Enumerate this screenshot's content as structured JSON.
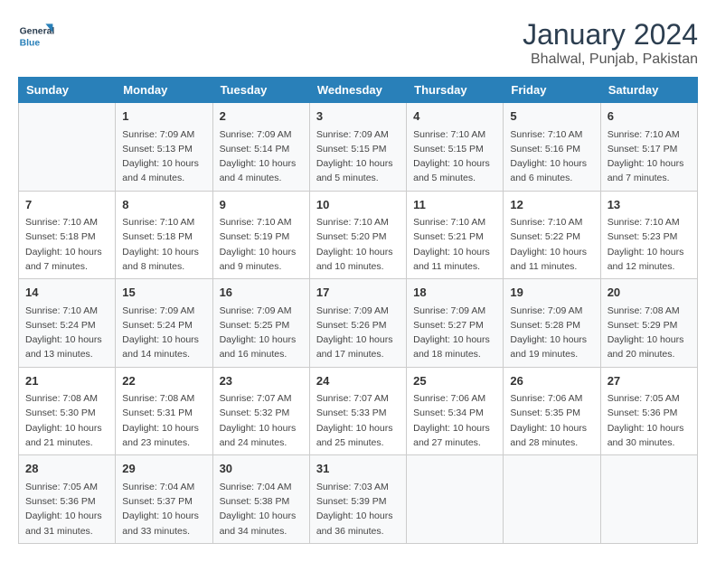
{
  "header": {
    "logo_general": "General",
    "logo_blue": "Blue",
    "title": "January 2024",
    "subtitle": "Bhalwal, Punjab, Pakistan"
  },
  "calendar": {
    "days_of_week": [
      "Sunday",
      "Monday",
      "Tuesday",
      "Wednesday",
      "Thursday",
      "Friday",
      "Saturday"
    ],
    "weeks": [
      [
        {
          "date": "",
          "info": ""
        },
        {
          "date": "1",
          "info": "Sunrise: 7:09 AM\nSunset: 5:13 PM\nDaylight: 10 hours\nand 4 minutes."
        },
        {
          "date": "2",
          "info": "Sunrise: 7:09 AM\nSunset: 5:14 PM\nDaylight: 10 hours\nand 4 minutes."
        },
        {
          "date": "3",
          "info": "Sunrise: 7:09 AM\nSunset: 5:15 PM\nDaylight: 10 hours\nand 5 minutes."
        },
        {
          "date": "4",
          "info": "Sunrise: 7:10 AM\nSunset: 5:15 PM\nDaylight: 10 hours\nand 5 minutes."
        },
        {
          "date": "5",
          "info": "Sunrise: 7:10 AM\nSunset: 5:16 PM\nDaylight: 10 hours\nand 6 minutes."
        },
        {
          "date": "6",
          "info": "Sunrise: 7:10 AM\nSunset: 5:17 PM\nDaylight: 10 hours\nand 7 minutes."
        }
      ],
      [
        {
          "date": "7",
          "info": "Sunrise: 7:10 AM\nSunset: 5:18 PM\nDaylight: 10 hours\nand 7 minutes."
        },
        {
          "date": "8",
          "info": "Sunrise: 7:10 AM\nSunset: 5:18 PM\nDaylight: 10 hours\nand 8 minutes."
        },
        {
          "date": "9",
          "info": "Sunrise: 7:10 AM\nSunset: 5:19 PM\nDaylight: 10 hours\nand 9 minutes."
        },
        {
          "date": "10",
          "info": "Sunrise: 7:10 AM\nSunset: 5:20 PM\nDaylight: 10 hours\nand 10 minutes."
        },
        {
          "date": "11",
          "info": "Sunrise: 7:10 AM\nSunset: 5:21 PM\nDaylight: 10 hours\nand 11 minutes."
        },
        {
          "date": "12",
          "info": "Sunrise: 7:10 AM\nSunset: 5:22 PM\nDaylight: 10 hours\nand 11 minutes."
        },
        {
          "date": "13",
          "info": "Sunrise: 7:10 AM\nSunset: 5:23 PM\nDaylight: 10 hours\nand 12 minutes."
        }
      ],
      [
        {
          "date": "14",
          "info": "Sunrise: 7:10 AM\nSunset: 5:24 PM\nDaylight: 10 hours\nand 13 minutes."
        },
        {
          "date": "15",
          "info": "Sunrise: 7:09 AM\nSunset: 5:24 PM\nDaylight: 10 hours\nand 14 minutes."
        },
        {
          "date": "16",
          "info": "Sunrise: 7:09 AM\nSunset: 5:25 PM\nDaylight: 10 hours\nand 16 minutes."
        },
        {
          "date": "17",
          "info": "Sunrise: 7:09 AM\nSunset: 5:26 PM\nDaylight: 10 hours\nand 17 minutes."
        },
        {
          "date": "18",
          "info": "Sunrise: 7:09 AM\nSunset: 5:27 PM\nDaylight: 10 hours\nand 18 minutes."
        },
        {
          "date": "19",
          "info": "Sunrise: 7:09 AM\nSunset: 5:28 PM\nDaylight: 10 hours\nand 19 minutes."
        },
        {
          "date": "20",
          "info": "Sunrise: 7:08 AM\nSunset: 5:29 PM\nDaylight: 10 hours\nand 20 minutes."
        }
      ],
      [
        {
          "date": "21",
          "info": "Sunrise: 7:08 AM\nSunset: 5:30 PM\nDaylight: 10 hours\nand 21 minutes."
        },
        {
          "date": "22",
          "info": "Sunrise: 7:08 AM\nSunset: 5:31 PM\nDaylight: 10 hours\nand 23 minutes."
        },
        {
          "date": "23",
          "info": "Sunrise: 7:07 AM\nSunset: 5:32 PM\nDaylight: 10 hours\nand 24 minutes."
        },
        {
          "date": "24",
          "info": "Sunrise: 7:07 AM\nSunset: 5:33 PM\nDaylight: 10 hours\nand 25 minutes."
        },
        {
          "date": "25",
          "info": "Sunrise: 7:06 AM\nSunset: 5:34 PM\nDaylight: 10 hours\nand 27 minutes."
        },
        {
          "date": "26",
          "info": "Sunrise: 7:06 AM\nSunset: 5:35 PM\nDaylight: 10 hours\nand 28 minutes."
        },
        {
          "date": "27",
          "info": "Sunrise: 7:05 AM\nSunset: 5:36 PM\nDaylight: 10 hours\nand 30 minutes."
        }
      ],
      [
        {
          "date": "28",
          "info": "Sunrise: 7:05 AM\nSunset: 5:36 PM\nDaylight: 10 hours\nand 31 minutes."
        },
        {
          "date": "29",
          "info": "Sunrise: 7:04 AM\nSunset: 5:37 PM\nDaylight: 10 hours\nand 33 minutes."
        },
        {
          "date": "30",
          "info": "Sunrise: 7:04 AM\nSunset: 5:38 PM\nDaylight: 10 hours\nand 34 minutes."
        },
        {
          "date": "31",
          "info": "Sunrise: 7:03 AM\nSunset: 5:39 PM\nDaylight: 10 hours\nand 36 minutes."
        },
        {
          "date": "",
          "info": ""
        },
        {
          "date": "",
          "info": ""
        },
        {
          "date": "",
          "info": ""
        }
      ]
    ]
  }
}
